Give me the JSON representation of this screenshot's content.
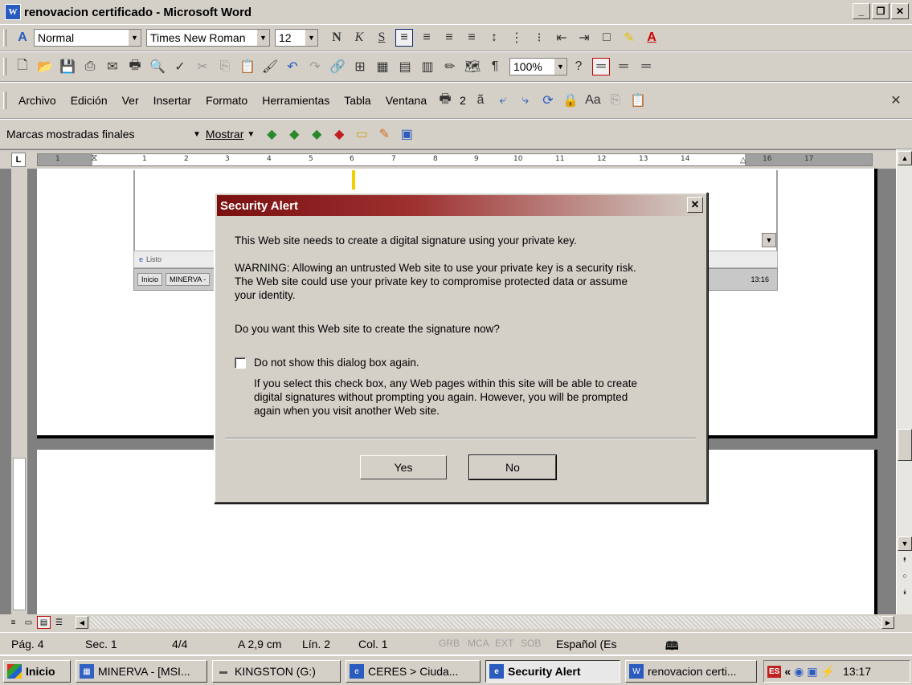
{
  "window": {
    "title": "renovacion certificado - Microsoft Word"
  },
  "format_toolbar": {
    "style": "Normal",
    "font": "Times New Roman",
    "size": "12"
  },
  "standard_toolbar": {
    "zoom": "100%"
  },
  "menu": {
    "items": [
      "Archivo",
      "Edición",
      "Ver",
      "Insertar",
      "Formato",
      "Herramientas",
      "Tabla",
      "Ventana",
      "2"
    ]
  },
  "review_toolbar": {
    "markup": "Marcas mostradas finales",
    "show": "Mostrar"
  },
  "ruler": {
    "numbers": [
      "1",
      "1",
      "2",
      "3",
      "4",
      "5",
      "6",
      "7",
      "8",
      "9",
      "10",
      "11",
      "12",
      "13",
      "14",
      "16",
      "17"
    ]
  },
  "embedded": {
    "status": "Listo",
    "task_start": "Inicio",
    "task_minerva": "MINERVA -",
    "time": "13:16"
  },
  "dialog": {
    "title": "Security Alert",
    "line1": "This Web site needs to create a digital signature using your private key.",
    "warning1": "WARNING: Allowing an untrusted Web site to use your private key is a security risk.",
    "warning2": "The Web site could use your private key to compromise protected data or assume",
    "warning3": "your identity.",
    "question": "Do you want this Web site to create the signature now?",
    "checkbox_label": "Do not show this dialog box again.",
    "note1": "If you select this check box, any Web pages within this site will be able to create",
    "note2": "digital signatures without prompting you again. However, you will be prompted",
    "note3": "again when you visit another Web site.",
    "yes": "Yes",
    "no": "No"
  },
  "status": {
    "page": "Pág. 4",
    "sec": "Sec. 1",
    "count": "4/4",
    "at": "A 2,9 cm",
    "line": "Lín. 2",
    "col": "Col. 1",
    "grb": "GRB",
    "mca": "MCA",
    "ext": "EXT",
    "sob": "SOB",
    "lang": "Español (Es"
  },
  "taskbar": {
    "start": "Inicio",
    "items": [
      "MINERVA - [MSI...",
      "KINGSTON (G:)",
      "CERES > Ciuda...",
      "Security Alert",
      "renovacion certi..."
    ],
    "time": "13:17"
  }
}
